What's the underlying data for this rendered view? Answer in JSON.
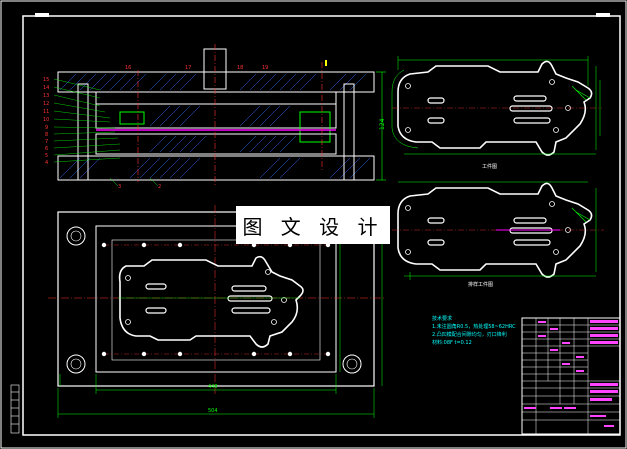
{
  "drawing": {
    "background": "#000000",
    "colors": {
      "border": "#ffffff",
      "outline": "#ffffff",
      "line_green": "#00ff00",
      "dim_red": "#ff3333",
      "section_blue": "#3366ff",
      "accent_magenta": "#ff00ff",
      "center_yellow": "#ffff00",
      "note_cyan": "#00ffff",
      "title_magenta": "#ff44ff"
    },
    "part_labels_top": [
      "16",
      "17",
      "18",
      "19"
    ],
    "part_labels_left": [
      "15",
      "14",
      "13",
      "12",
      "11",
      "10",
      "9",
      "8",
      "7",
      "6",
      "5",
      "4"
    ],
    "part_labels_bottom": [
      "3",
      "2"
    ],
    "view_label_part": "工件图",
    "view_label_strip": "排样工件图",
    "dim_right_height": "124",
    "dim_plate_width_inner": "448",
    "dim_plate_width_outer": "504",
    "notes": {
      "heading": "技术要求",
      "line1": "1.未注圆角R0.5，热处理58~62HRC",
      "line2": "2.凸凹模配合间隙均匀，刃口锋利",
      "line3": "材料:08F   t=0.12"
    }
  },
  "watermark": {
    "text": "图 文 设 计"
  },
  "icons": {
    "hole": "circle-hole-icon",
    "center_mark": "crosshair-icon"
  }
}
